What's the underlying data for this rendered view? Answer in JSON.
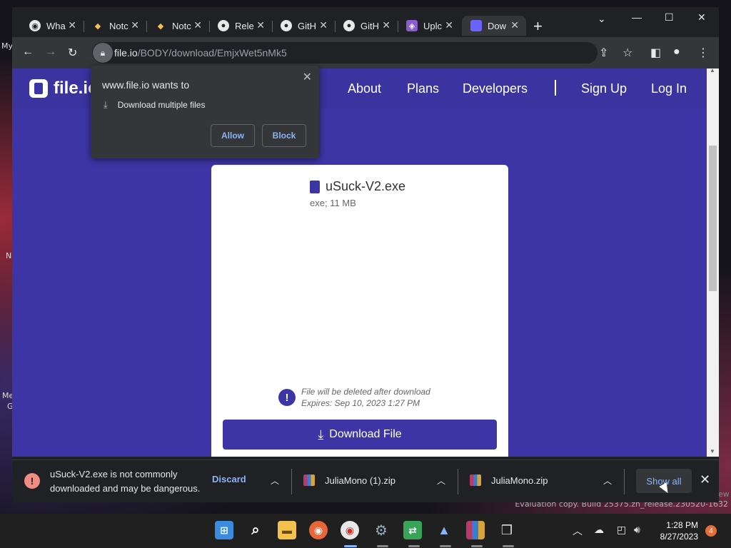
{
  "desktop": {
    "fragments": [
      "My",
      "N",
      "Me",
      "G",
      "ew"
    ],
    "evaluation_note": "Evaluation copy. Build 25375.zn_release.230520-1632"
  },
  "browser": {
    "tabs": [
      {
        "title": "Wha",
        "icon": "chrome-icon",
        "color": "#e8e8e8"
      },
      {
        "title": "Notc",
        "icon": "notion-icon",
        "color": "#f2c14e"
      },
      {
        "title": "Notc",
        "icon": "notion-icon",
        "color": "#f2c14e"
      },
      {
        "title": "Rele",
        "icon": "github-icon",
        "color": "#e8e8e8"
      },
      {
        "title": "GitH",
        "icon": "github-icon",
        "color": "#e8e8e8"
      },
      {
        "title": "GitH",
        "icon": "github-icon",
        "color": "#e8e8e8"
      },
      {
        "title": "Uplc",
        "icon": "upload-icon",
        "color": "#8a5cd0"
      },
      {
        "title": "Dow",
        "icon": "fileio-icon",
        "color": "#6c63ff"
      }
    ],
    "url_host": "file.io",
    "url_path": "/BODY/download/EmjxWet5nMk5"
  },
  "site": {
    "logo": "file.io",
    "nav": [
      "About",
      "Plans",
      "Developers",
      "|",
      "Sign Up",
      "Log In"
    ],
    "accent": "#3d35a6"
  },
  "file": {
    "name": "uSuck-V2.exe",
    "meta": "exe; 11 MB",
    "notice_line1": "File will be deleted after download",
    "notice_line2": "Expires: Sep 10, 2023 1:27 PM",
    "download_label": "Download File"
  },
  "permission": {
    "title": "www.file.io wants to",
    "item": "Download multiple files",
    "allow": "Allow",
    "block": "Block"
  },
  "shelf": {
    "warning_line1": "uSuck-V2.exe is not commonly",
    "warning_line2": "downloaded and may be dangerous.",
    "discard": "Discard",
    "items": [
      "JuliaMono (1).zip",
      "JuliaMono.zip"
    ],
    "show_all": "Show all"
  },
  "taskbar": {
    "time": "1:28 PM",
    "date": "8/27/2023",
    "notifications": "4"
  }
}
